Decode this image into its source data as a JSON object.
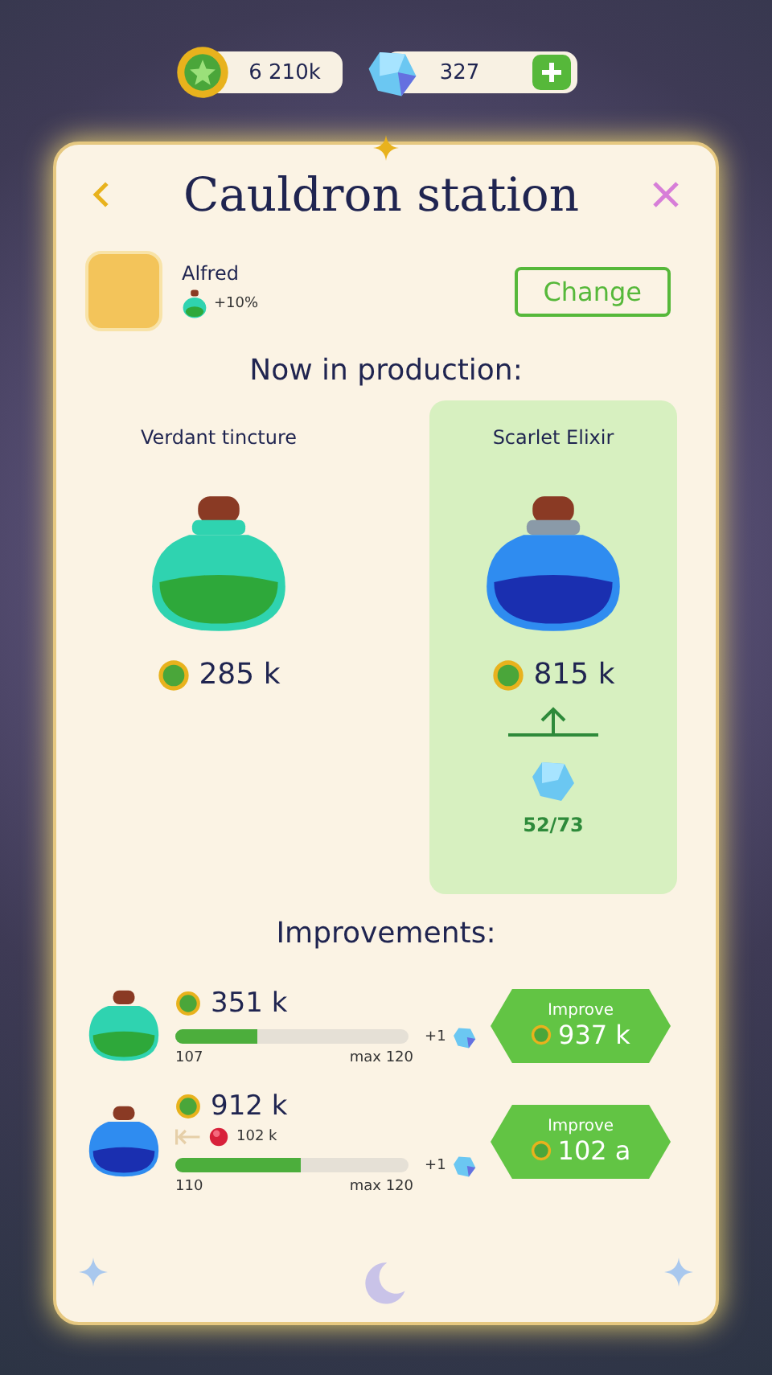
{
  "currency": [
    {
      "kind": "coin",
      "amount": "6 210k",
      "addable": false
    },
    {
      "kind": "gem",
      "amount": "327",
      "addable": true
    }
  ],
  "title": "Cauldron station",
  "worker": {
    "name": "Alfred",
    "bonus": "+10%",
    "button": "Change"
  },
  "production": {
    "heading": "Now in production:",
    "products": [
      {
        "name": "Verdant tincture",
        "kind": "green",
        "price": "285 k",
        "selected": false
      },
      {
        "name": "Scarlet Elixir",
        "kind": "blue",
        "price": "815 k",
        "selected": true,
        "upgrade_progress": "52/73"
      }
    ]
  },
  "improvements": {
    "heading": "Improvements:",
    "rows": [
      {
        "kind": "green",
        "price": "351 k",
        "level": 0.35,
        "start": "107",
        "max": "max 120",
        "reward": "+1",
        "button_label": "Improve",
        "button_price": "937 k"
      },
      {
        "kind": "blue",
        "price": "912 k",
        "extra_cost": "102 k",
        "level": 0.54,
        "start": "110",
        "max": "max 120",
        "reward": "+1",
        "button_label": "Improve",
        "button_price": "102 a"
      }
    ]
  }
}
